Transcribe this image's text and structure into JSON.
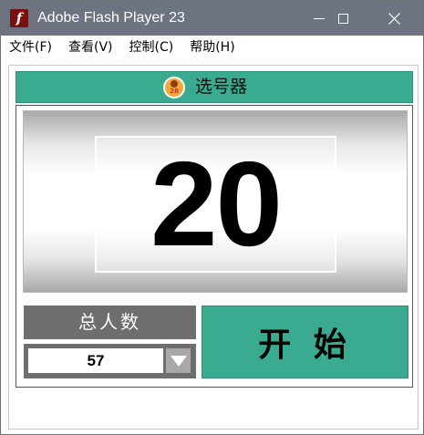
{
  "window": {
    "title": "Adobe Flash Player 23",
    "app_icon_glyph": "f"
  },
  "menu": {
    "items": [
      {
        "label": "文件(F)"
      },
      {
        "label": "查看(V)"
      },
      {
        "label": "控制(C)"
      },
      {
        "label": "帮助(H)"
      }
    ]
  },
  "app": {
    "header_title": "选号器",
    "badge_number": "28",
    "current_number": "20",
    "total_label": "总人数",
    "total_value": "57",
    "start_label": "开 始"
  },
  "colors": {
    "accent": "#3aab91",
    "titlebar": "#6d7380",
    "panel_gray": "#6e6e6e"
  }
}
